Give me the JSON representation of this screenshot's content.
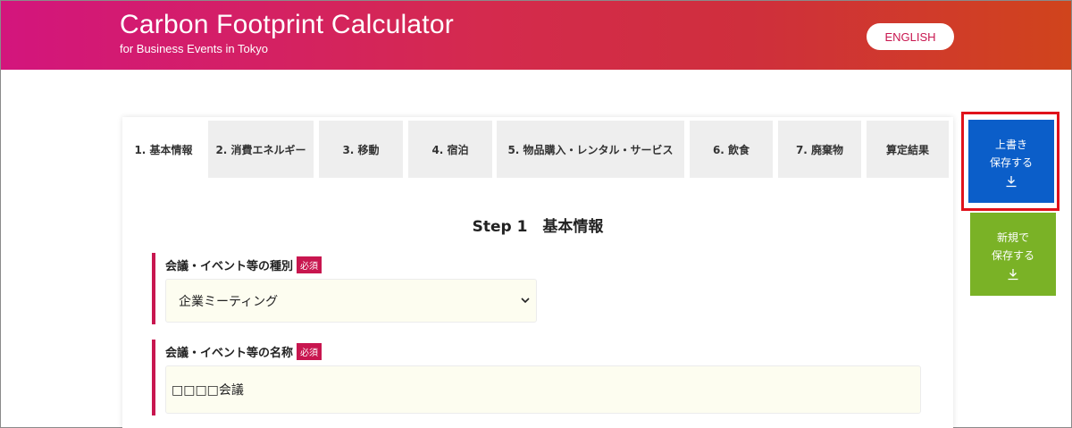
{
  "header": {
    "title": "Carbon Footprint Calculator",
    "subtitle": "for Business Events in Tokyo",
    "language_button": "ENGLISH"
  },
  "tabs": [
    {
      "label": "1. 基本情報",
      "active": true
    },
    {
      "label": "2. 消費エネルギー",
      "active": false
    },
    {
      "label": "3. 移動",
      "active": false
    },
    {
      "label": "4. 宿泊",
      "active": false
    },
    {
      "label": "5. 物品購入・レンタル・サービス",
      "active": false
    },
    {
      "label": "6. 飲食",
      "active": false
    },
    {
      "label": "7. 廃棄物",
      "active": false
    },
    {
      "label": "算定結果",
      "active": false
    }
  ],
  "step": {
    "title": "Step 1　基本情報"
  },
  "fields": {
    "event_type": {
      "label": "会議・イベント等の種別",
      "required_badge": "必須",
      "value": "企業ミーティング"
    },
    "event_name": {
      "label": "会議・イベント等の名称",
      "required_badge": "必須",
      "value": "□□□□会議"
    }
  },
  "actions": {
    "overwrite_save": {
      "line1": "上書き",
      "line2": "保存する",
      "icon": "download-icon",
      "color": "#0b5ec9"
    },
    "new_save": {
      "line1": "新規で",
      "line2": "保存する",
      "icon": "download-icon",
      "color": "#7ab226"
    }
  },
  "colors": {
    "accent": "#c8164f",
    "highlight": "#e0121b"
  }
}
